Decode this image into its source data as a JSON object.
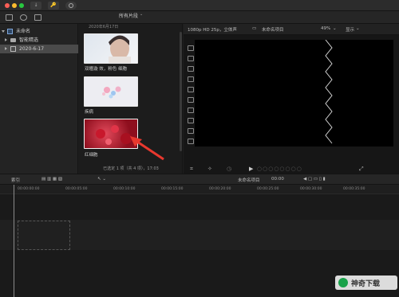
{
  "toolbar": {
    "key_label": "🔑"
  },
  "sidebar": {
    "items": [
      {
        "label": "未命名",
        "kind": "library"
      },
      {
        "label": "智能精选",
        "kind": "folder"
      },
      {
        "label": "2020-6-17",
        "kind": "event",
        "selected": true
      }
    ]
  },
  "browser": {
    "filter_label": "所有片段",
    "date_label": "2020年6月17日",
    "clips": [
      {
        "label": "双瞳漩 效，粉色 细胞"
      },
      {
        "label": "疾病"
      },
      {
        "label": "红细胞"
      }
    ],
    "footer": "已选定 1 项（共 4 项），17:03"
  },
  "viewer": {
    "format": "1080p HD 25p，立体声",
    "project": "未命名项目",
    "zoom": "49%",
    "display": "显示"
  },
  "timeline": {
    "index_label": "索引",
    "project_name": "未命名项目",
    "timecode": "00:00",
    "ruler": [
      "00:00:00:00",
      "00:00:05:00",
      "00:00:10:00",
      "00:00:15:00",
      "00:00:20:00",
      "00:00:25:00",
      "00:00:30:00",
      "00:00:35:00",
      "00:00:40:00",
      "00:00:45:00",
      "00:00:50:00"
    ]
  },
  "watermark": {
    "text": "神奇下载"
  },
  "colors": {
    "accent": "#e8382e",
    "selected_row": "#4a4a4a",
    "viewer_bg": "#000000"
  }
}
